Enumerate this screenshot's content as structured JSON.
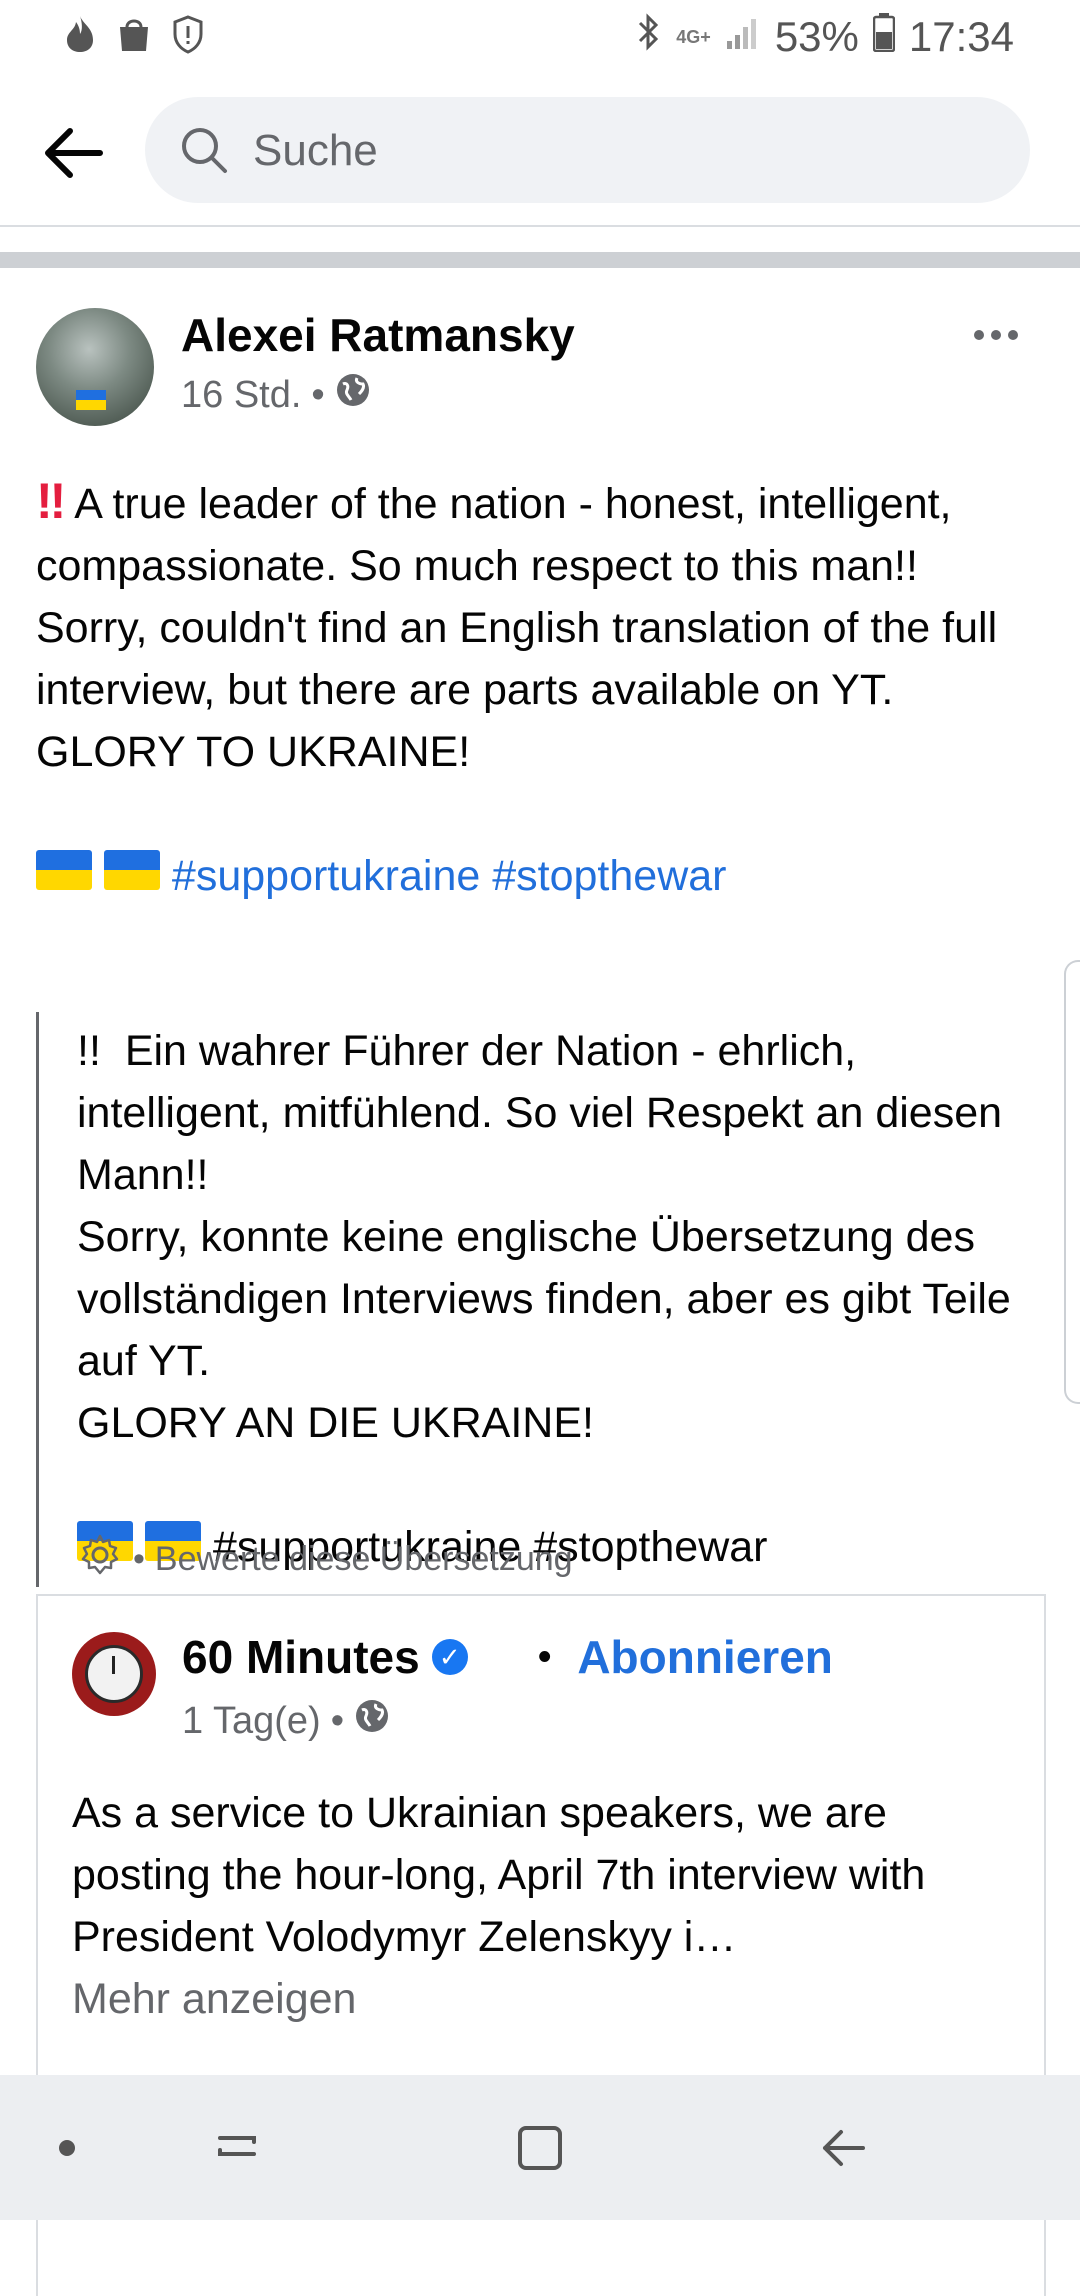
{
  "status_bar": {
    "left_icons": [
      "flame-icon",
      "shopping-bag-icon",
      "shield-alert-icon"
    ],
    "right_icons": [
      "bluetooth-icon",
      "network-4g-icon",
      "signal-icon"
    ],
    "network": "4G+",
    "battery": "53%",
    "time": "17:34"
  },
  "header": {
    "search_placeholder": "Suche"
  },
  "post": {
    "author": "Alexei Ratmansky",
    "time": "16 Std.",
    "privacy_icon": "globe-icon",
    "paragraphs": [
      "A true leader of the nation - honest, intelligent, compassionate. So much respect to this man!!",
      "Sorry, couldn't find an English translation of the full interview, but there are parts available on YT.",
      "GLORY TO UKRAINE!"
    ],
    "hashtags": "#supportukraine #stopthewar"
  },
  "translation": {
    "prefix": "!!",
    "paragraphs": [
      "Ein wahrer Führer der Nation - ehrlich, intelligent, mitfühlend. So viel Respekt an diesen Mann!!",
      "Sorry, konnte keine englische Übersetzung des vollständigen Interviews finden, aber es gibt Teile auf YT.",
      "GLORY AN DIE UKRAINE!"
    ],
    "hashtags": "#supportukraine #stopthewar",
    "rate_label": "Bewerte diese Übersetzung"
  },
  "shared": {
    "page_name": "60 Minutes",
    "subscribe_label": "Abonnieren",
    "time": "1 Tag(e)",
    "text": "As a service to Ukrainian speakers, we are posting the hour-long, April 7th interview with President Volodymyr Zelenskyy i…",
    "see_more": "Mehr anzeigen"
  },
  "colors": {
    "link": "#216fdb",
    "ukraine_blue": "#1f6fe0",
    "ukraine_yellow": "#ffd700"
  }
}
